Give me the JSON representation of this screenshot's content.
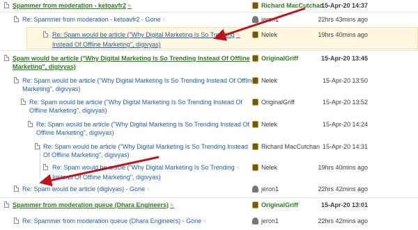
{
  "threads": [
    {
      "subject": "Spammer from moderation - ketoavfr2",
      "author": "Richard MacCutchan",
      "date": "15-Apr-20 14:37"
    },
    {
      "subject": "Re: Spammer from moderation - ketoavfr2 - Gone",
      "author": "jeron1",
      "date": "22hrs 43mins ago"
    },
    {
      "subject_l1": "Re: Spam would be article (\"Why Digital Marketing Is So Trending",
      "subject_l2": "Instead Of Offline Marketing\", digivyas)",
      "author": "Nelek",
      "date": "19hrs 40mins ago"
    },
    {
      "subject_l1": "Spam would be article (\"Why Digital Marketing Is So Trending Instead Of Offline",
      "subject_l2": "Marketing\", digivyas)",
      "author": "OriginalGriff",
      "date": "15-Apr-20 13:45"
    },
    {
      "subject_l1": "Re: Spam would be article (\"Why Digital Marketing Is So Trending Instead Of Offline",
      "subject_l2": "Marketing\", digivyas)",
      "author": "Nelek",
      "date": "15-Apr-20 13:50"
    },
    {
      "subject_l1": "Re: Spam would be article (\"Why Digital Marketing Is So Trending Instead Of",
      "subject_l2": "Offline Marketing\", digivyas)",
      "author": "OriginalGriff",
      "date": "15-Apr-20 13:52"
    },
    {
      "subject_l1": "Re: Spam would be article (\"Why Digital Marketing Is So Trending Instead Of",
      "subject_l2": "Offline Marketing\", digivyas)",
      "author": "Nelek",
      "date": "15-Apr-20 14:24"
    },
    {
      "subject_l1": "Re: Spam would be article (\"Why Digital Marketing Is So Trending Instead",
      "subject_l2": "Of Offline Marketing\", digivyas)",
      "author": "Richard MacCutchan",
      "date": "15-Apr-20 14:31"
    },
    {
      "subject_l1": "Re: Spam would be article (\"Why Digital Marketing Is So Trending",
      "subject_l2": "Instead Of Offline Marketing\", digivyas)",
      "author": "Nelek",
      "date": "19hrs 40mins ago"
    },
    {
      "subject": "Re: Spam would be article (digivyas) - Gone",
      "author": "jeron1",
      "date": "22hrs 42mins ago"
    },
    {
      "subject": "Spammer from moderation queue (Dhara Engineers)",
      "author": "OriginalGriff",
      "date": "15-Apr-20 13:01"
    },
    {
      "subject": "Re: Spammer from moderation queue (Dhara Engineers) - Gone",
      "author": "jeron1",
      "date": "22hrs 42mins ago"
    }
  ],
  "pin_glyph": "✎",
  "colors": {
    "thread_green": "#2e7d1f",
    "link_blue": "#1f5fa8",
    "arrow_red": "#c0141a",
    "highlight": "#fff7e0"
  }
}
